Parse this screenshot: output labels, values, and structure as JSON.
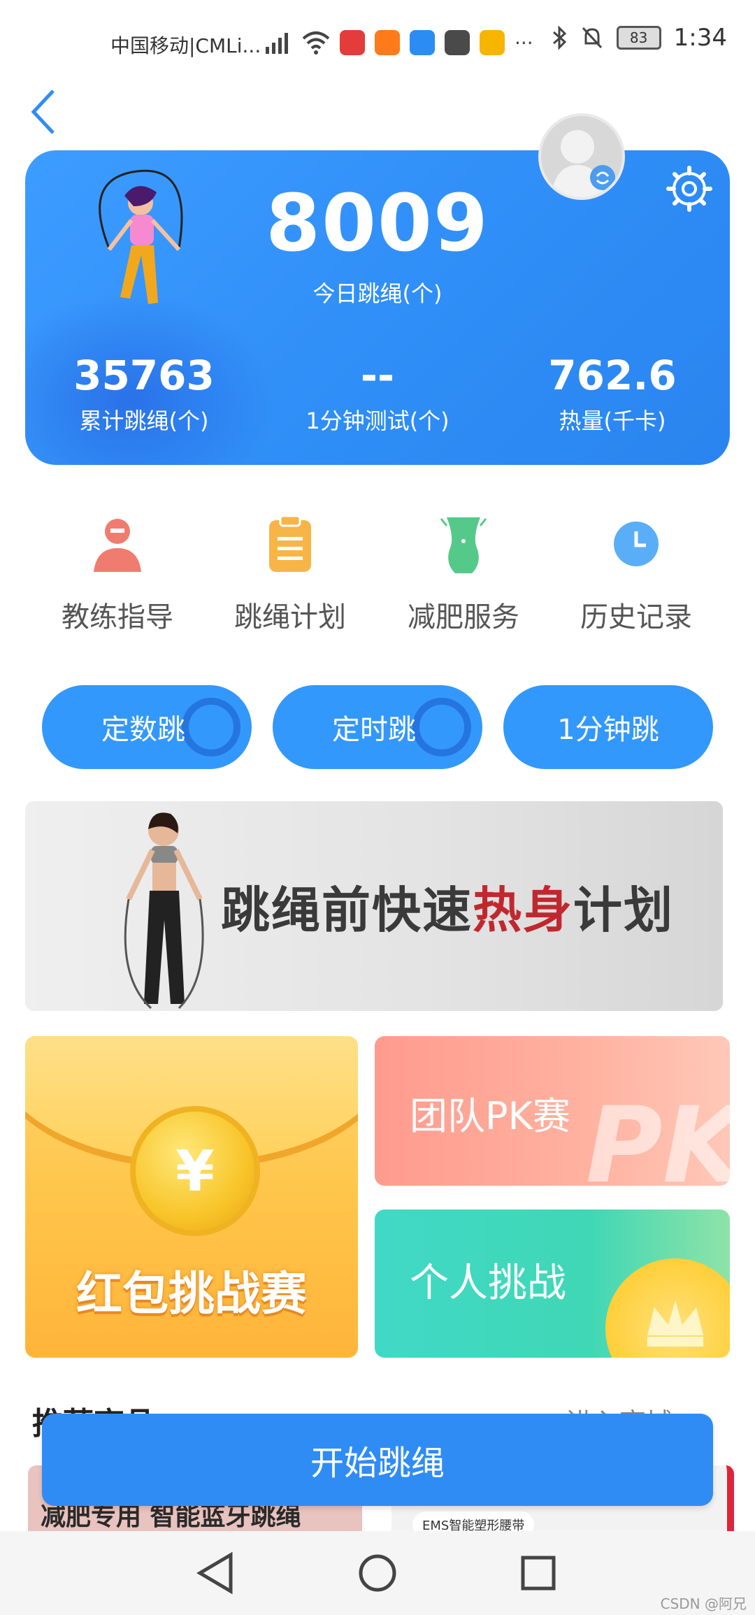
{
  "status_bar": {
    "carrier": "中国移动|CMLi...",
    "battery": "83",
    "time": "1:34",
    "app_icon_colors": [
      "#e43b3b",
      "#ff7a18",
      "#2b8cf3",
      "#4a4a4a",
      "#f7b500"
    ]
  },
  "hero": {
    "today_value": "8009",
    "today_label": "今日跳绳(个)",
    "stats": [
      {
        "value": "35763",
        "label": "累计跳绳(个)"
      },
      {
        "value": "--",
        "label": "1分钟测试(个)"
      },
      {
        "value": "762.6",
        "label": "热量(千卡)"
      }
    ]
  },
  "menu": [
    {
      "label": "教练指导",
      "icon": "coach-icon",
      "color": "#f07c70"
    },
    {
      "label": "跳绳计划",
      "icon": "clipboard-icon",
      "color": "#f7b548"
    },
    {
      "label": "减肥服务",
      "icon": "waist-icon",
      "color": "#55c98a"
    },
    {
      "label": "历史记录",
      "icon": "clock-icon",
      "color": "#5aaef7"
    }
  ],
  "modes": [
    "定数跳",
    "定时跳",
    "1分钟跳"
  ],
  "banner": {
    "text_prefix": "跳绳前快速",
    "text_highlight": "热身",
    "text_suffix": "计划"
  },
  "cards": {
    "red_packet": "红包挑战赛",
    "red_packet_coin": "¥",
    "pk": "团队PK赛",
    "pk_bg": "PK",
    "solo": "个人挑战"
  },
  "recommend": {
    "title": "推荐商品",
    "more": "进入商城",
    "product1": "减肥专用 智能蓝牙跳绳",
    "product2": "EMS智能塑形腰带"
  },
  "start_button": "开始跳绳",
  "watermark": "CSDN @阿兄"
}
